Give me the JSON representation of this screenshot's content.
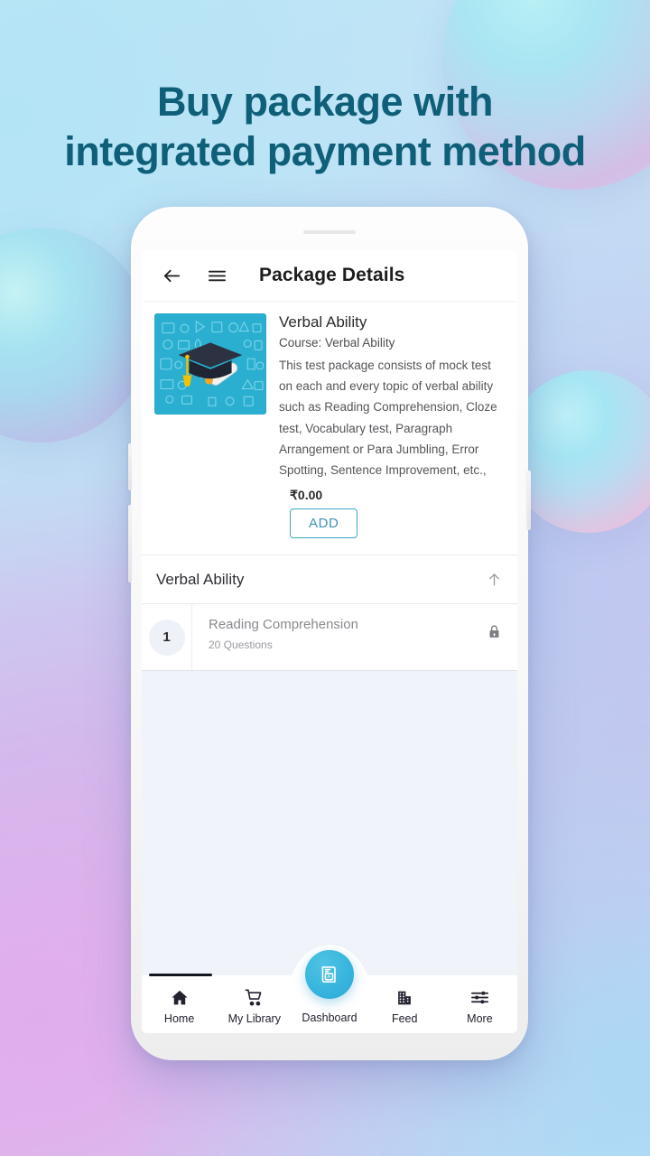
{
  "headline": {
    "line1": "Buy package with",
    "line2": "integrated payment method",
    "color": "#0f5f78"
  },
  "phone": {
    "appbar": {
      "back_icon": "arrow-left-icon",
      "menu_icon": "hamburger-menu-icon",
      "title": "Package Details"
    },
    "package": {
      "thumbnail_alt": "graduation-cap-diploma-illustration",
      "thumbnail_color": "#2bafd0",
      "title": "Verbal Ability",
      "course": "Course: Verbal Ability",
      "description": "This test package consists of mock test on each and every topic of verbal ability such as Reading Comprehension, Cloze test, Vocabulary test, Paragraph Arrangement or Para Jumbling, Error Spotting, Sentence Improvement, etc.,",
      "price": "₹0.00",
      "add_label": "ADD",
      "add_color": "#3e93b4"
    },
    "section": {
      "title": "Verbal Ability",
      "collapse_icon": "arrow-up-icon",
      "items": [
        {
          "number": "1",
          "title": "Reading Comprehension",
          "subtitle": "20 Questions",
          "locked": true,
          "lock_icon": "lock-icon"
        }
      ]
    },
    "bottom_nav": {
      "items": [
        {
          "label": "Home",
          "icon": "home-icon"
        },
        {
          "label": "My Library",
          "icon": "cart-icon"
        },
        {
          "label": "Dashboard",
          "icon": "book-a-icon"
        },
        {
          "label": "Feed",
          "icon": "building-icon"
        },
        {
          "label": "More",
          "icon": "sliders-icon"
        }
      ],
      "fab_color": "#36b4dd"
    }
  }
}
